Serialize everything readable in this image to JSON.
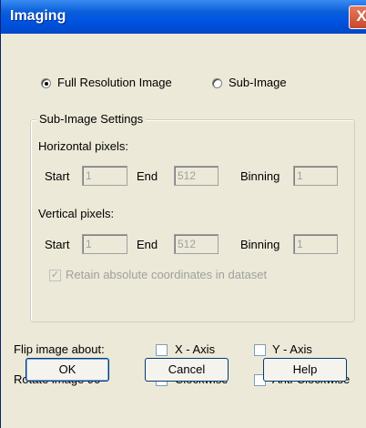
{
  "window": {
    "title": "Imaging",
    "close_glyph": "X"
  },
  "mode": {
    "full_label": "Full Resolution Image",
    "sub_label": "Sub-Image",
    "selected": "full"
  },
  "subimage": {
    "legend": "Sub-Image Settings",
    "horizontal": {
      "label": "Horizontal pixels:",
      "start_label": "Start",
      "start_value": "1",
      "end_label": "End",
      "end_value": "512",
      "binning_label": "Binning",
      "binning_value": "1"
    },
    "vertical": {
      "label": "Vertical pixels:",
      "start_label": "Start",
      "start_value": "1",
      "end_label": "End",
      "end_value": "512",
      "binning_label": "Binning",
      "binning_value": "1"
    },
    "retain_label": "Retain absolute coordinates in dataset",
    "retain_checked": true
  },
  "flip": {
    "label": "Flip image about:",
    "x_label": "X - Axis",
    "y_label": "Y - Axis"
  },
  "rotate": {
    "label": "Rotate image 90°",
    "cw_label": "Clockwise",
    "acw_label": "Anti-Clockwise"
  },
  "buttons": {
    "ok": "OK",
    "cancel": "Cancel",
    "help": "Help"
  }
}
